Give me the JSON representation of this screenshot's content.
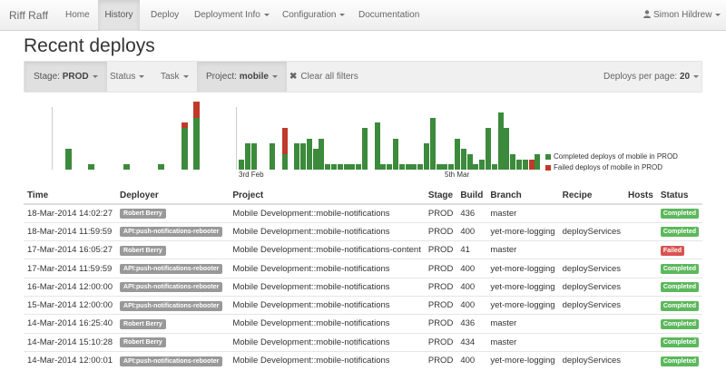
{
  "navbar": {
    "brand": "Riff Raff",
    "items": [
      {
        "label": "Home"
      },
      {
        "label": "History"
      },
      {
        "label": "Deploy"
      },
      {
        "label": "Deployment Info"
      },
      {
        "label": "Configuration"
      },
      {
        "label": "Documentation"
      }
    ],
    "user": "Simon Hildrew"
  },
  "page_title": "Recent deploys",
  "filters": {
    "stage_label": "Stage:",
    "stage_value": "PROD",
    "status_label": "Status",
    "task_label": "Task",
    "project_label": "Project:",
    "project_value": "mobile",
    "clear_label": "Clear all filters",
    "per_page_label": "Deploys per page:",
    "per_page_value": "20"
  },
  "chart_data": {
    "type": "bar",
    "stacked": true,
    "x_tick_labels": [
      "3rd Feb",
      "5th Mar"
    ],
    "series": [
      {
        "name": "Completed deploys of mobile in PROD",
        "color": "#3c8a3c"
      },
      {
        "name": "Failed deploys of mobile in PROD",
        "color": "#c0392b"
      }
    ],
    "panel_left": {
      "completed": [
        0,
        4,
        0,
        1,
        0,
        0,
        1,
        0,
        0,
        1,
        0,
        8,
        10
      ],
      "failed": [
        0,
        0,
        0,
        0,
        0,
        0,
        0,
        0,
        0,
        0,
        0,
        1,
        3
      ]
    },
    "panel_right": {
      "completed": [
        2,
        5,
        5,
        0,
        0,
        5,
        0,
        3,
        0,
        5,
        5,
        6,
        4,
        6,
        1,
        1,
        1,
        1,
        1,
        1,
        8,
        0,
        9,
        1,
        1,
        6,
        1,
        1,
        1,
        1,
        5,
        10,
        1,
        1,
        1,
        6,
        4,
        3,
        1,
        2,
        8,
        1,
        11,
        8,
        3,
        2,
        2,
        0,
        3
      ],
      "failed": [
        0,
        0,
        0,
        0,
        0,
        0,
        0,
        5,
        0,
        0,
        0,
        0,
        0,
        0,
        0,
        0,
        0,
        0,
        0,
        0,
        0,
        0,
        0,
        0,
        0,
        0,
        0,
        0,
        0,
        0,
        0,
        0,
        0,
        0,
        0,
        0,
        0,
        0,
        0,
        0,
        0,
        0,
        0,
        0,
        0,
        0,
        0,
        2,
        0
      ]
    }
  },
  "table": {
    "headers": [
      "Time",
      "Deployer",
      "Project",
      "Stage",
      "Build",
      "Branch",
      "Recipe",
      "Hosts",
      "Status"
    ],
    "rows": [
      {
        "time": "18-Mar-2014 14:02:27",
        "deployer": "Robert Berry",
        "project": "Mobile Development::mobile-notifications",
        "stage": "PROD",
        "build": "436",
        "branch": "master",
        "recipe": "",
        "hosts": "",
        "status": "Completed",
        "status_color": "#5cb85c"
      },
      {
        "time": "18-Mar-2014 11:59:59",
        "deployer": "API:push-notifications-rebooter",
        "project": "Mobile Development::mobile-notifications",
        "stage": "PROD",
        "build": "400",
        "branch": "yet-more-logging",
        "recipe": "deployServices",
        "hosts": "",
        "status": "Completed",
        "status_color": "#5cb85c"
      },
      {
        "time": "17-Mar-2014 16:05:27",
        "deployer": "Robert Berry",
        "project": "Mobile Development::mobile-notifications-content",
        "stage": "PROD",
        "build": "41",
        "branch": "master",
        "recipe": "",
        "hosts": "",
        "status": "Failed",
        "status_color": "#d9534f"
      },
      {
        "time": "17-Mar-2014 11:59:59",
        "deployer": "API:push-notifications-rebooter",
        "project": "Mobile Development::mobile-notifications",
        "stage": "PROD",
        "build": "400",
        "branch": "yet-more-logging",
        "recipe": "deployServices",
        "hosts": "",
        "status": "Completed",
        "status_color": "#5cb85c"
      },
      {
        "time": "16-Mar-2014 12:00:00",
        "deployer": "API:push-notifications-rebooter",
        "project": "Mobile Development::mobile-notifications",
        "stage": "PROD",
        "build": "400",
        "branch": "yet-more-logging",
        "recipe": "deployServices",
        "hosts": "",
        "status": "Completed",
        "status_color": "#5cb85c"
      },
      {
        "time": "15-Mar-2014 12:00:00",
        "deployer": "API:push-notifications-rebooter",
        "project": "Mobile Development::mobile-notifications",
        "stage": "PROD",
        "build": "400",
        "branch": "yet-more-logging",
        "recipe": "deployServices",
        "hosts": "",
        "status": "Completed",
        "status_color": "#5cb85c"
      },
      {
        "time": "14-Mar-2014 16:25:40",
        "deployer": "Robert Berry",
        "project": "Mobile Development::mobile-notifications",
        "stage": "PROD",
        "build": "436",
        "branch": "master",
        "recipe": "",
        "hosts": "",
        "status": "Completed",
        "status_color": "#5cb85c"
      },
      {
        "time": "14-Mar-2014 15:10:28",
        "deployer": "Robert Berry",
        "project": "Mobile Development::mobile-notifications",
        "stage": "PROD",
        "build": "434",
        "branch": "master",
        "recipe": "",
        "hosts": "",
        "status": "Completed",
        "status_color": "#5cb85c"
      },
      {
        "time": "14-Mar-2014 12:00:01",
        "deployer": "API:push-notifications-rebooter",
        "project": "Mobile Development::mobile-notifications",
        "stage": "PROD",
        "build": "400",
        "branch": "yet-more-logging",
        "recipe": "deployServices",
        "hosts": "",
        "status": "Completed",
        "status_color": "#5cb85c"
      }
    ]
  }
}
